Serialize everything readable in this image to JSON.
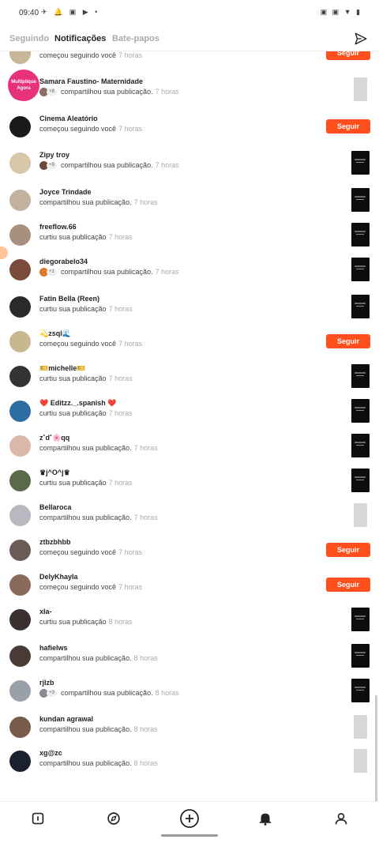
{
  "status_bar": {
    "time": "09:40",
    "left_icons": "✈ 🔔 ▣ ▶ •",
    "right_icons": "▣ ▣ ▼ ▮"
  },
  "tabs": [
    {
      "label": "Seguindo"
    },
    {
      "label": "Notificações",
      "active": true
    },
    {
      "label": "Bate-papos"
    }
  ],
  "promo_badge": {
    "text": "Multiplique Agora"
  },
  "notifications": [
    {
      "name": "",
      "action": "começou seguindo você",
      "time": "7 horas",
      "button": "Seguir"
    },
    {
      "name": "Samara Faustino- Maternidade",
      "action": "compartilhou sua publicação.",
      "time": "7 horas",
      "count": "+8",
      "thumb": "light"
    },
    {
      "name": "Cinema Aleatório",
      "action": "começou seguindo você",
      "time": "7 horas",
      "button": "Seguir"
    },
    {
      "name": "Zipy troy",
      "action": "compartilhou sua publicação.",
      "time": "7 horas",
      "count": "+9",
      "thumb": "dark"
    },
    {
      "name": "Joyce Trindade",
      "action": "compartilhou sua publicação.",
      "time": "7 horas",
      "thumb": "dark"
    },
    {
      "name": "freeflow.66",
      "action": "curtiu sua publicação",
      "time": "7 horas",
      "thumb": "dark"
    },
    {
      "name": "diegorabelo34",
      "action": "compartilhou sua publicação.",
      "time": "7 horas",
      "count": "+1",
      "thumb": "dark"
    },
    {
      "name": "Fatin Bella (Reen)",
      "action": "curtiu sua publicação",
      "time": "7 horas",
      "thumb": "dark"
    },
    {
      "name": "💫zsql🌊",
      "action": "começou seguindo você",
      "time": "7 horas",
      "button": "Seguir"
    },
    {
      "name": "🎫michelle🎫",
      "action": "curtiu sua publicação",
      "time": "7 horas",
      "thumb": "dark"
    },
    {
      "name": "❤️ Editzz._.spanish ❤️",
      "action": "curtiu sua publicação",
      "time": "7 horas",
      "thumb": "dark"
    },
    {
      "name": "z˚d˚🌸qq",
      "action": "compartilhou sua publicação.",
      "time": "7 horas",
      "thumb": "dark"
    },
    {
      "name": "♛j^O^j♛",
      "action": "curtiu sua publicação",
      "time": "7 horas",
      "thumb": "dark"
    },
    {
      "name": "Bellaroca",
      "action": "compartilhou sua publicação.",
      "time": "7 horas",
      "thumb": "light"
    },
    {
      "name": "ztbzbhbb",
      "action": "começou seguindo você",
      "time": "7 horas",
      "button": "Seguir"
    },
    {
      "name": "DelyKhayla",
      "action": "começou seguindo você",
      "time": "7 horas",
      "button": "Seguir"
    },
    {
      "name": "xla-",
      "action": "curtiu sua publicação",
      "time": "8 horas",
      "thumb": "dark"
    },
    {
      "name": "hafielws",
      "action": "compartilhou sua publicação.",
      "time": "8 horas",
      "thumb": "dark"
    },
    {
      "name": "rjlzb",
      "action": "compartilhou sua publicação.",
      "time": "8 horas",
      "count": "+3",
      "thumb": "dark"
    },
    {
      "name": "kundan agrawal",
      "action": "compartilhou sua publicação.",
      "time": "8 horas",
      "thumb": "light"
    },
    {
      "name": "xg@zc",
      "action": "compartilhou sua publicação.",
      "time": "8 horas",
      "thumb": "light"
    }
  ],
  "bottom_nav": [
    {
      "icon": "home-icon"
    },
    {
      "icon": "discover-icon"
    },
    {
      "icon": "create-plus-icon"
    },
    {
      "icon": "bell-icon",
      "active": true
    },
    {
      "icon": "profile-icon"
    }
  ],
  "colors": {
    "accent": "#fe4f1c"
  }
}
